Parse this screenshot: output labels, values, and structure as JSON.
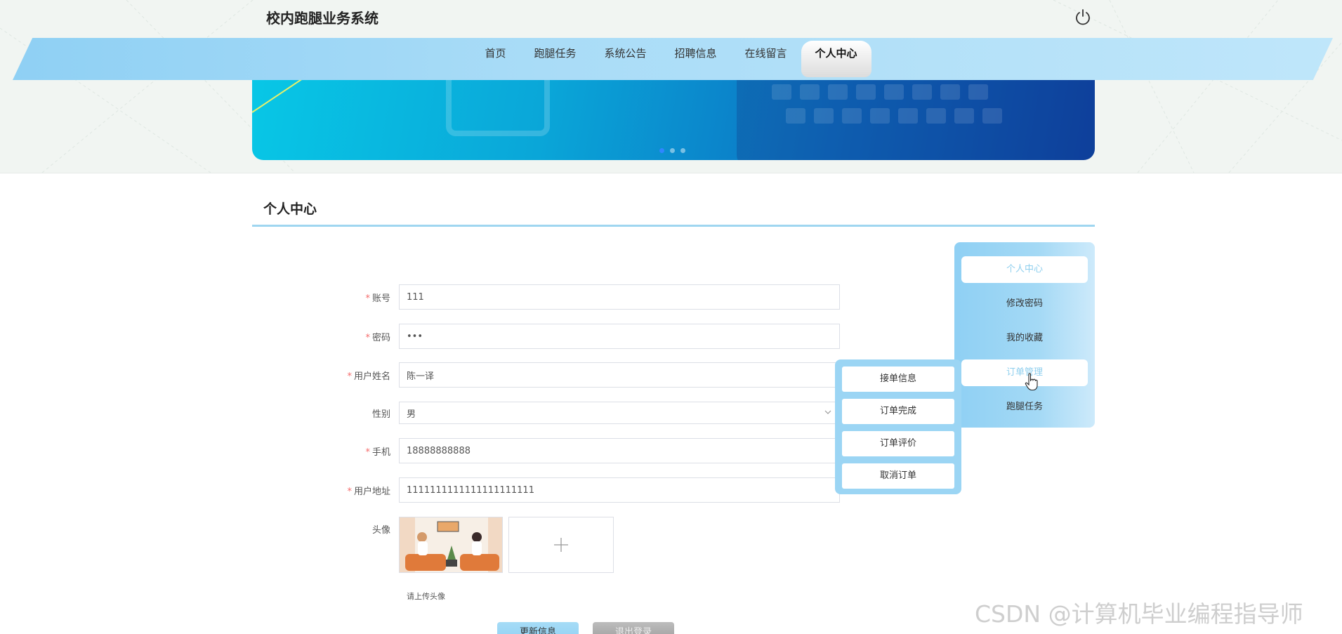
{
  "header": {
    "site_title": "校内跑腿业务系统",
    "icons": {
      "power": "power-icon"
    }
  },
  "nav": {
    "items": [
      {
        "label": "首页",
        "active": false
      },
      {
        "label": "跑腿任务",
        "active": false
      },
      {
        "label": "系统公告",
        "active": false
      },
      {
        "label": "招聘信息",
        "active": false
      },
      {
        "label": "在线留言",
        "active": false
      },
      {
        "label": "个人中心",
        "active": true
      }
    ]
  },
  "banner": {
    "dots": 3,
    "active_dot": 1
  },
  "section": {
    "title": "个人中心"
  },
  "form": {
    "account": {
      "label": "账号",
      "required": true,
      "value": "111"
    },
    "password": {
      "label": "密码",
      "required": true,
      "value": "•••"
    },
    "username": {
      "label": "用户姓名",
      "required": true,
      "value": "陈一译"
    },
    "gender": {
      "label": "性别",
      "required": false,
      "value": "男"
    },
    "phone": {
      "label": "手机",
      "required": true,
      "value": "18888888888"
    },
    "address": {
      "label": "用户地址",
      "required": true,
      "value": "1111111111111111111111"
    },
    "avatar": {
      "label": "头像",
      "hint": "请上传头像",
      "add_icon": "plus-icon"
    },
    "buttons": {
      "update": "更新信息",
      "logout": "退出登录"
    }
  },
  "side_menu": {
    "items": [
      {
        "label": "个人中心",
        "state": "active"
      },
      {
        "label": "修改密码",
        "state": "normal"
      },
      {
        "label": "我的收藏",
        "state": "normal"
      },
      {
        "label": "订单管理",
        "state": "hover"
      },
      {
        "label": "跑腿任务",
        "state": "normal"
      }
    ]
  },
  "sub_menu": {
    "items": [
      {
        "label": "接单信息"
      },
      {
        "label": "订单完成"
      },
      {
        "label": "订单评价"
      },
      {
        "label": "取消订单"
      }
    ]
  },
  "watermark": "CSDN @计算机毕业编程指导师",
  "colors": {
    "accent": "#8fd0f4",
    "required": "#f56c6c",
    "active_text": "#8fcfee"
  }
}
